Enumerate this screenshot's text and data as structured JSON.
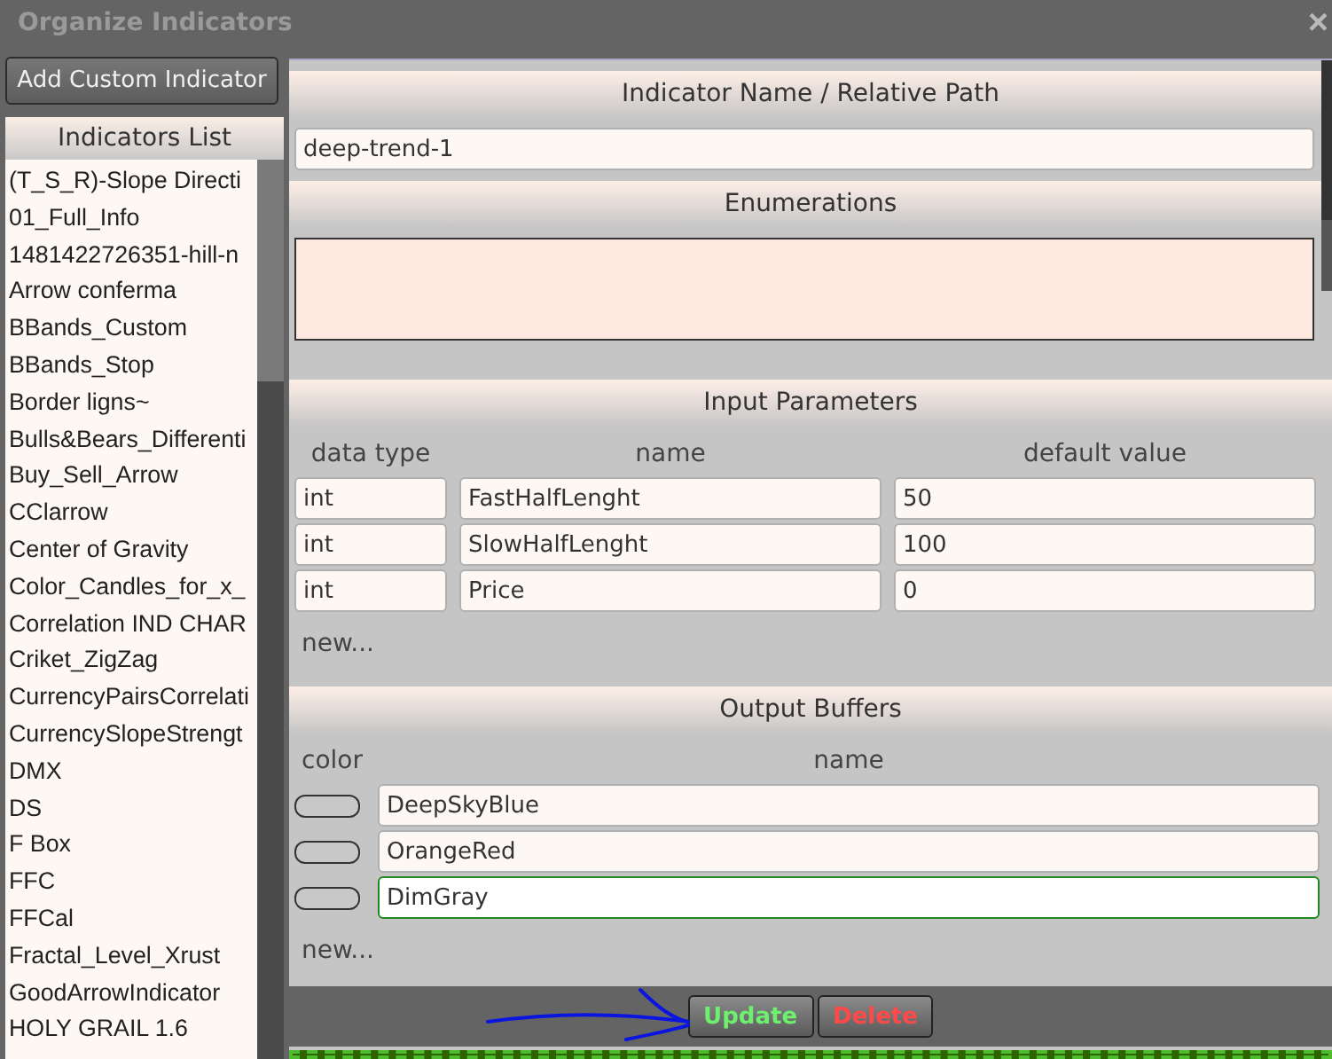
{
  "window": {
    "title": "Organize Indicators",
    "close": "×"
  },
  "add_button": "Add Custom Indicator",
  "indicators_list": {
    "title": "Indicators List",
    "items": [
      {
        "label": "(T_S_R)-Slope Directi"
      },
      {
        "label": "01_Full_Info"
      },
      {
        "label": "1481422726351-hill-n"
      },
      {
        "label": "Arrow conferma"
      },
      {
        "label": "BBands_Custom"
      },
      {
        "label": "BBands_Stop"
      },
      {
        "label": "Border ligns~"
      },
      {
        "label": "Bulls&Bears_Differenti"
      },
      {
        "label": "Buy_Sell_Arrow"
      },
      {
        "label": "CClarrow"
      },
      {
        "label": "Center of Gravity"
      },
      {
        "label": "Color_Candles_for_x_"
      },
      {
        "label": "Correlation IND CHAR"
      },
      {
        "label": "Criket_ZigZag"
      },
      {
        "label": "CurrencyPairsCorrelati"
      },
      {
        "label": "CurrencySlopeStrengt"
      },
      {
        "label": "DMX"
      },
      {
        "label": "DS"
      },
      {
        "label": "F Box"
      },
      {
        "label": "FFC"
      },
      {
        "label": "FFCal"
      },
      {
        "label": "Fractal_Level_Xrust"
      },
      {
        "label": "GoodArrowIndicator"
      },
      {
        "label": "HOLY GRAIL 1.6"
      }
    ]
  },
  "name_section": {
    "title": "Indicator Name / Relative Path",
    "value": "deep-trend-1"
  },
  "enumerations": {
    "title": "Enumerations"
  },
  "input_parameters": {
    "title": "Input Parameters",
    "columns": [
      "data type",
      "name",
      "default value"
    ],
    "rows": [
      {
        "data_type": "int",
        "name": "FastHalfLenght",
        "default_value": "50"
      },
      {
        "data_type": "int",
        "name": "SlowHalfLenght",
        "default_value": "100"
      },
      {
        "data_type": "int",
        "name": "Price",
        "default_value": "0"
      }
    ],
    "new_link": "new..."
  },
  "output_buffers": {
    "title": "Output Buffers",
    "columns": [
      "color",
      "name"
    ],
    "rows": [
      {
        "name": "DeepSkyBlue",
        "focused": false
      },
      {
        "name": "OrangeRed",
        "focused": false
      },
      {
        "name": "DimGray",
        "focused": true
      }
    ],
    "new_link": "new..."
  },
  "actions": {
    "update": "Update",
    "delete": "Delete"
  }
}
